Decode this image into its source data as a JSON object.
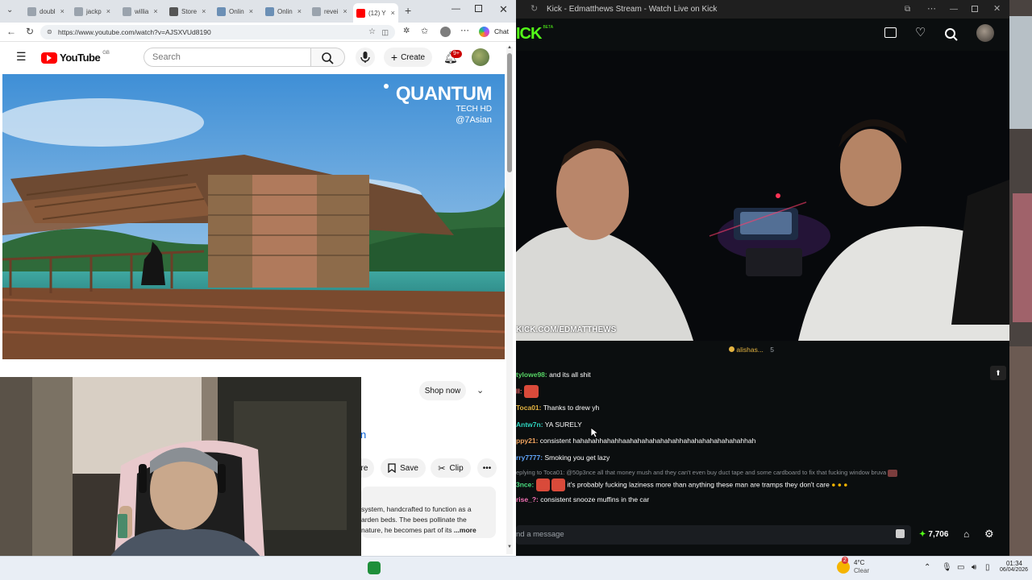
{
  "left_browser": {
    "tabs": [
      {
        "label": "doubl"
      },
      {
        "label": "jackp"
      },
      {
        "label": "willia"
      },
      {
        "label": "Store"
      },
      {
        "label": "Onlin"
      },
      {
        "label": "Onlin"
      },
      {
        "label": "revei"
      },
      {
        "label": "(12) Y"
      }
    ],
    "url": "https://www.youtube.com/watch?v=AJSXVUd8190",
    "chat_button": "Chat"
  },
  "youtube": {
    "logo_text": "YouTube",
    "logo_region": "GB",
    "search_placeholder": "Search",
    "create_label": "Create",
    "notification_count": "9+",
    "watermark_title": "QUANTUM",
    "watermark_sub": "TECH HD",
    "watermark_handle": "@7Asian",
    "shop_label": "Shop now",
    "title_fragment": "n",
    "share_fragment": "re",
    "save_label": "Save",
    "clip_label": "Clip",
    "description_lines": [
      "system, handcrafted to function as a",
      "arden beds. The bees pollinate the",
      "nature, he becomes part of its"
    ],
    "more_label": "...more"
  },
  "kick": {
    "window_title": "Kick - Edmatthews Stream - Watch Live on Kick",
    "logo_text": "ICK",
    "logo_badge": "BETA",
    "stream_watermark": "KICK.COM/EDMATTHEWS",
    "pinned": {
      "user": "alishas...",
      "count": "5"
    },
    "chat": [
      {
        "user": "tylowe98:",
        "text": "and its all shit",
        "color": "#56d364"
      },
      {
        "user": "ll:",
        "text": "",
        "color": "#ff6b6b"
      },
      {
        "user": "Toca01:",
        "text": "Thanks to drew yh",
        "color": "#e3b341"
      },
      {
        "user": "Antw7n:",
        "text": "YA SURELY",
        "color": "#2dd4bf"
      },
      {
        "user": "ppy21:",
        "text": "consistent hahahahhahahhaahahahahahahahhahahahahahahahahhah",
        "color": "#f0a35e"
      },
      {
        "user": "rry7777:",
        "text": "Smoking you get lazy",
        "color": "#60a5fa"
      },
      {
        "user": "eplying to Toca01:",
        "text": "@50p3nce all that money mush and they can't even buy duct tape and some cardboard to fix that fucking window bruva",
        "color": "#8b8f94"
      },
      {
        "user": "3nce:",
        "text": "it's probably fucking laziness more than anything these man are tramps they don't care",
        "color": "#4ade80"
      },
      {
        "user": "rise_?:",
        "text": "consistent snooze muffins in the car",
        "color": "#f472b6"
      }
    ],
    "input_placeholder": "nd a message",
    "points": "7,706"
  },
  "taskbar": {
    "weather_badge": "2",
    "weather_temp": "4°C",
    "weather_desc": "Clear",
    "time": "01:34",
    "date": "06/04/2026"
  }
}
